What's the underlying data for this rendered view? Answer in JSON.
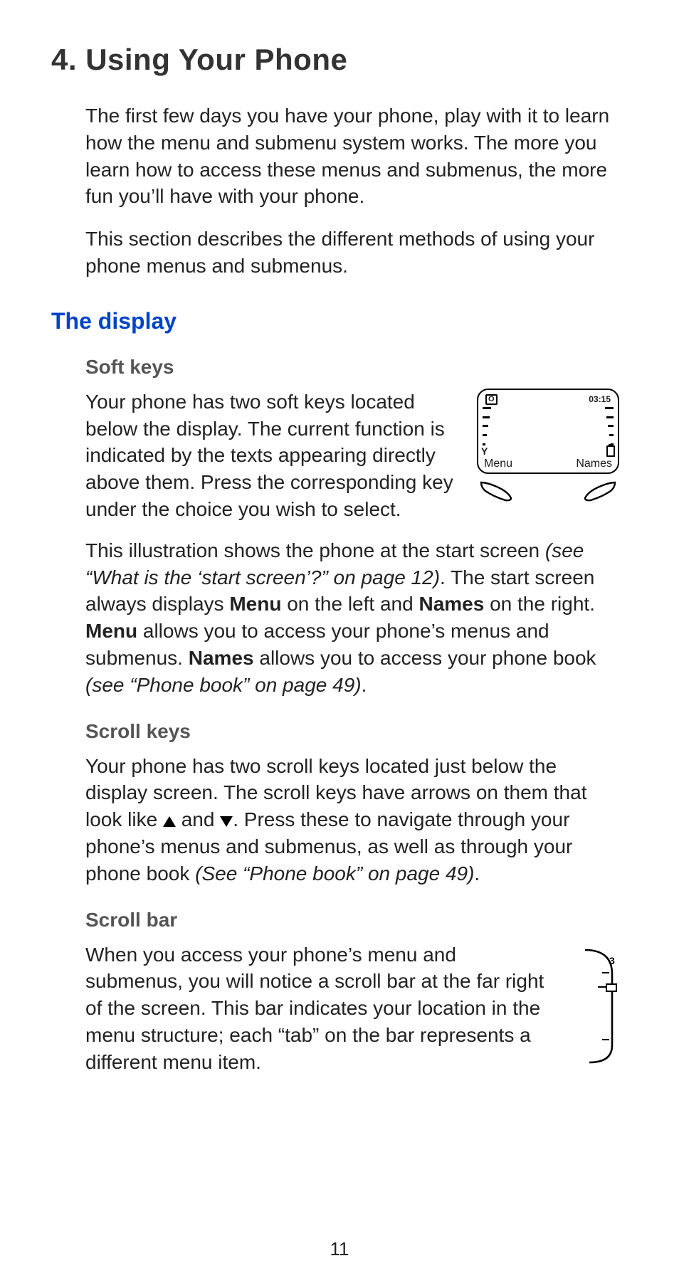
{
  "chapter": {
    "title": "4. Using Your Phone"
  },
  "intro": {
    "p1": "The first few days you have your phone, play with it to learn how the menu and submenu system works. The more you learn how to access these menus and submenus, the more fun you’ll have with your phone.",
    "p2": "This section describes the different methods of using your phone menus and submenus."
  },
  "section": {
    "display": "The display"
  },
  "softkeys": {
    "head": "Soft keys",
    "p1": "Your phone has two soft keys located below the display. The current function is indicated by the texts appearing directly above them. Press the corresponding key under the choice you wish to select.",
    "p2a": "This illustration shows the phone at the start screen ",
    "p2_ref1": "(see “What is the ‘start screen’?” on page 12)",
    "p2b": ". The start screen always displays ",
    "menu_bold1": "Menu",
    "p2c": " on the left and ",
    "names_bold1": "Names",
    "p2d": " on the right. ",
    "menu_bold2": "Menu",
    "p2e": " allows you to access your phone’s menus and submenus. ",
    "names_bold2": "Names",
    "p2f": " allows you to access your phone book ",
    "p2_ref2": "(see “Phone book” on page 49)",
    "p2g": "."
  },
  "phone_illus": {
    "operator_icon": "O",
    "time": "03:15",
    "soft_left": "Menu",
    "soft_right": "Names"
  },
  "scrollkeys": {
    "head": "Scroll keys",
    "p1a": "Your phone has two scroll keys located just below the display screen. The scroll keys have arrows on them that look like ",
    "and": " and ",
    "p1b": ". Press these to navigate through your phone’s menus and submenus, as well as through your phone book ",
    "ref": "(See “Phone book” on page 49)",
    "p1c": "."
  },
  "scrollbar": {
    "head": "Scroll bar",
    "p1": "When you access your phone’s menu and submenus, you will notice a scroll bar at the far right of the screen. This bar indicates your location in the menu structure; each “tab” on the bar represents a different menu item.",
    "indicator": "3"
  },
  "page_number": "11"
}
